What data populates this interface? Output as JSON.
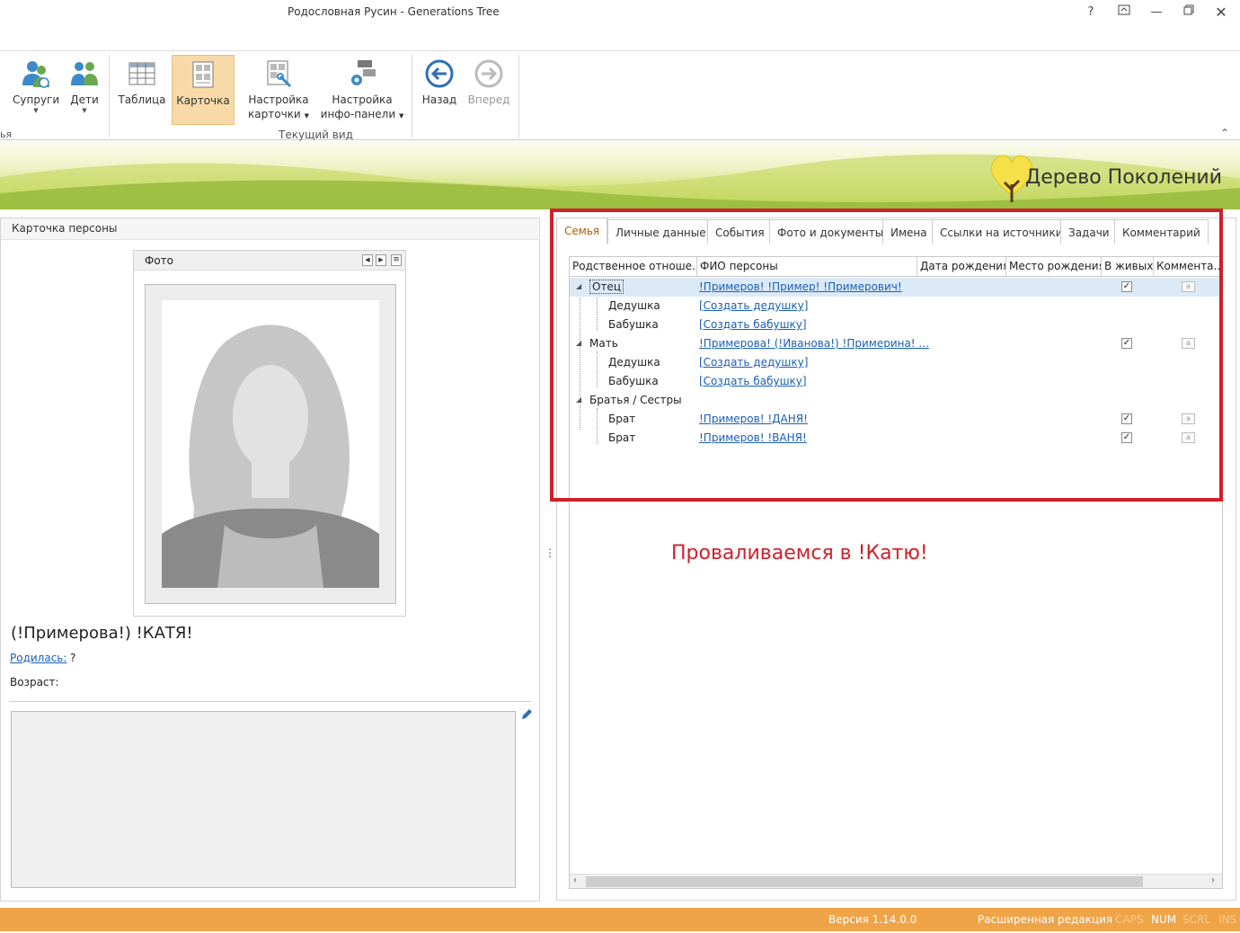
{
  "window": {
    "title": "Родословная Русин - Generations Tree",
    "help": "?",
    "controls": [
      "restore-ribbon",
      "minimize",
      "maximize",
      "close"
    ]
  },
  "ribbon": {
    "partial_group_label": "ья",
    "buttons": [
      {
        "label": "Супруги",
        "icon": "spouses-icon"
      },
      {
        "label": "Дети",
        "icon": "children-icon"
      },
      {
        "label": "Таблица",
        "icon": "table-icon"
      },
      {
        "label": "Карточка",
        "icon": "card-icon",
        "active": true
      },
      {
        "label": "Настройка карточки",
        "icon": "card-settings-icon"
      },
      {
        "label": "Настройка инфо-панели",
        "icon": "infopanel-settings-icon"
      },
      {
        "label": "Назад",
        "icon": "back-icon"
      },
      {
        "label": "Вперед",
        "icon": "forward-icon",
        "disabled": true
      }
    ],
    "group_label": "Текущий вид",
    "collapse": "^"
  },
  "banner": {
    "brand": "Дерево Поколений"
  },
  "card": {
    "header": "Карточка персоны",
    "photo_header": "Фото",
    "name": "(!Примерова!) !КАТЯ!",
    "born_label": "Родилась:",
    "born_value": "?",
    "age_label": "Возраст:"
  },
  "tabs": [
    "Семья",
    "Личные данные",
    "События",
    "Фото и документы",
    "Имена",
    "Ссылки на источники",
    "Задачи",
    "Комментарий"
  ],
  "grid": {
    "columns": [
      "Родственное отноше...",
      "ФИО персоны",
      "Дата рождения",
      "Место рождения",
      "В живых",
      "Коммента..."
    ],
    "rows": [
      {
        "relation": "Отец",
        "name": "!Примеров! !Пример! !Примерович!",
        "alive": "✓",
        "comment": "a",
        "level": 0,
        "selected": true
      },
      {
        "relation": "Дедушка",
        "name": "[Создать дедушку]",
        "alive": "",
        "comment": "",
        "level": 1
      },
      {
        "relation": "Бабушка",
        "name": "[Создать бабушку]",
        "alive": "",
        "comment": "",
        "level": 1
      },
      {
        "relation": "Мать",
        "name": "!Примерова! (!Иванова!) !Примерина! ...",
        "alive": "✓",
        "comment": "a",
        "level": 0
      },
      {
        "relation": "Дедушка",
        "name": "[Создать дедушку]",
        "alive": "",
        "comment": "",
        "level": 1
      },
      {
        "relation": "Бабушка",
        "name": "[Создать бабушку]",
        "alive": "",
        "comment": "",
        "level": 1
      },
      {
        "relation": "Братья / Сестры",
        "name": "",
        "alive": "",
        "comment": "",
        "level": 0
      },
      {
        "relation": "Брат",
        "name": "!Примеров! !ДАНЯ!",
        "alive": "✓",
        "comment": "a",
        "level": 1
      },
      {
        "relation": "Брат",
        "name": "!Примеров! !ВАНЯ!",
        "alive": "✓",
        "comment": "a",
        "level": 1
      }
    ]
  },
  "annotation": "Проваливаемся в !Катю!",
  "status": {
    "version": "Версия 1.14.0.0",
    "edition": "Расширенная редакция",
    "caps": "CAPS",
    "num": "NUM",
    "scrl": "SCRL",
    "ins": "INS"
  },
  "colors": {
    "accent": "#b35a00",
    "annotation": "#d0202a",
    "statusbar": "#f0a448",
    "link": "#1a5fb4"
  }
}
